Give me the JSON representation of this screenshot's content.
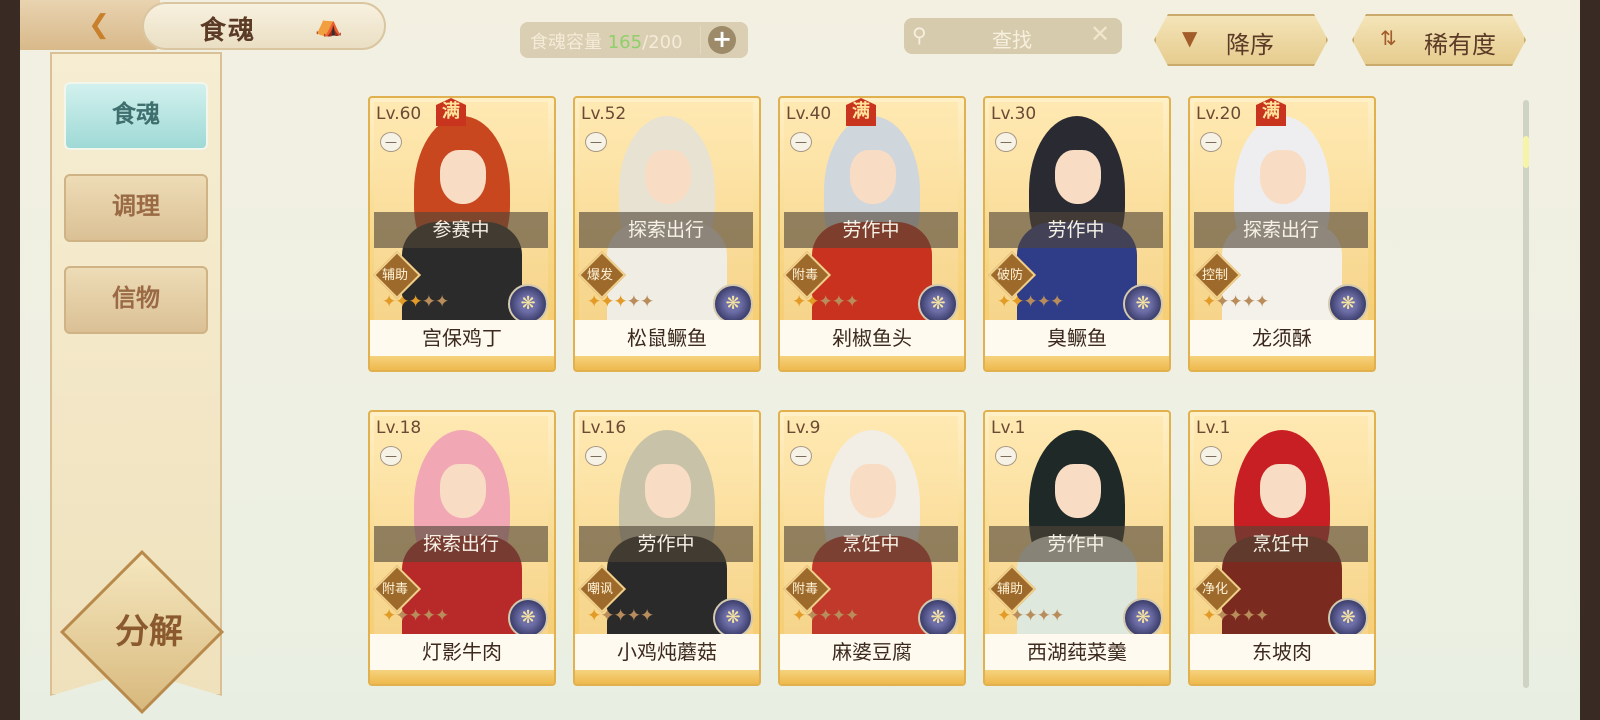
{
  "header": {
    "title": "食魂",
    "capacity_label": "食魂容量",
    "capacity_current": "165",
    "capacity_max": "/200",
    "search_placeholder": "查找",
    "sort_label": "降序",
    "rarity_label": "稀有度"
  },
  "sidebar": {
    "items": [
      {
        "label": "食魂",
        "active": true
      },
      {
        "label": "调理",
        "active": false
      },
      {
        "label": "信物",
        "active": false
      }
    ],
    "decompose_label": "分解"
  },
  "cards": [
    {
      "level": "Lv.60",
      "full": "满",
      "status": "参赛中",
      "role": "辅助",
      "stars": 3,
      "name": "宫保鸡丁",
      "hair": "#c8471f",
      "outfit": "#2b2b2b"
    },
    {
      "level": "Lv.52",
      "full": "",
      "status": "探索出行",
      "role": "爆发",
      "stars": 3,
      "name": "松鼠鳜鱼",
      "hair": "#e8e2d2",
      "outfit": "#f0ede4"
    },
    {
      "level": "Lv.40",
      "full": "满",
      "status": "劳作中",
      "role": "附毒",
      "stars": 2,
      "name": "剁椒鱼头",
      "hair": "#cfd6dc",
      "outfit": "#c8321f"
    },
    {
      "level": "Lv.30",
      "full": "",
      "status": "劳作中",
      "role": "破防",
      "stars": 2,
      "name": "臭鳜鱼",
      "hair": "#2a2a32",
      "outfit": "#2f3c88"
    },
    {
      "level": "Lv.20",
      "full": "满",
      "status": "探索出行",
      "role": "控制",
      "stars": 1,
      "name": "龙须酥",
      "hair": "#eeeef0",
      "outfit": "#f3f1ea"
    },
    {
      "level": "Lv.18",
      "full": "",
      "status": "探索出行",
      "role": "附毒",
      "stars": 1,
      "name": "灯影牛肉",
      "hair": "#f2a7b4",
      "outfit": "#b82a2a"
    },
    {
      "level": "Lv.16",
      "full": "",
      "status": "劳作中",
      "role": "嘲讽",
      "stars": 1,
      "name": "小鸡炖蘑菇",
      "hair": "#c8c2a8",
      "outfit": "#2a2a2a"
    },
    {
      "level": "Lv.9",
      "full": "",
      "status": "烹饪中",
      "role": "附毒",
      "stars": 1,
      "name": "麻婆豆腐",
      "hair": "#f2eee6",
      "outfit": "#c0392b"
    },
    {
      "level": "Lv.1",
      "full": "",
      "status": "劳作中",
      "role": "辅助",
      "stars": 1,
      "name": "西湖莼菜羹",
      "hair": "#1f2a28",
      "outfit": "#dfe8dc"
    },
    {
      "level": "Lv.1",
      "full": "",
      "status": "烹饪中",
      "role": "净化",
      "stars": 1,
      "name": "东坡肉",
      "hair": "#c81f24",
      "outfit": "#7a2a1e"
    }
  ]
}
